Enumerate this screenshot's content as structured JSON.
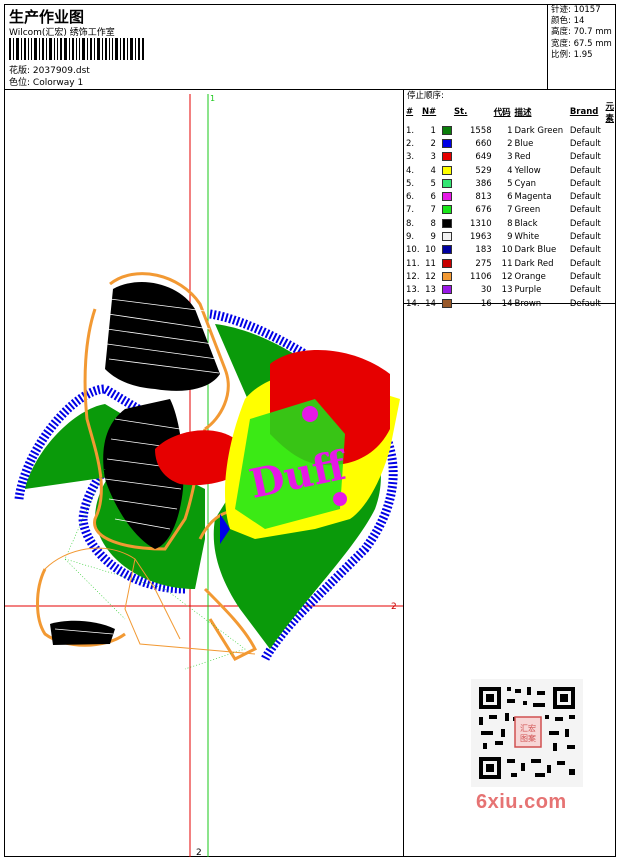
{
  "header": {
    "title": "生产作业图",
    "subtitle": "Wilcom(汇宏) 绣饰工作室",
    "design_file_label": "花版:",
    "design_file": "2037909.dst",
    "colorway_label": "色位:",
    "colorway": "Colorway 1"
  },
  "stats": {
    "stitches_label": "针迹:",
    "stitches": "10157",
    "colors_label": "颜色:",
    "colors": "14",
    "height_label": "高度:",
    "height": "70.7 mm",
    "width_label": "宽度:",
    "width": "67.5 mm",
    "scale_label": "比例:",
    "scale": "1.95"
  },
  "stop_sequence": {
    "title": "停止顺序:",
    "headers": {
      "idx": "#",
      "n": "N#",
      "st": "St.",
      "code": "代码",
      "desc": "描述",
      "brand": "Brand",
      "elem": "元素"
    },
    "rows": [
      {
        "idx": "1.",
        "n": "1",
        "st": "1558",
        "code": "1",
        "desc": "Dark Green",
        "brand": "Default",
        "color": "#0a7d0a"
      },
      {
        "idx": "2.",
        "n": "2",
        "st": "660",
        "code": "2",
        "desc": "Blue",
        "brand": "Default",
        "color": "#0000e6"
      },
      {
        "idx": "3.",
        "n": "3",
        "st": "649",
        "code": "3",
        "desc": "Red",
        "brand": "Default",
        "color": "#e60000"
      },
      {
        "idx": "4.",
        "n": "4",
        "st": "529",
        "code": "4",
        "desc": "Yellow",
        "brand": "Default",
        "color": "#ffff00"
      },
      {
        "idx": "5.",
        "n": "5",
        "st": "386",
        "code": "5",
        "desc": "Cyan",
        "brand": "Default",
        "color": "#33e673"
      },
      {
        "idx": "6.",
        "n": "6",
        "st": "813",
        "code": "6",
        "desc": "Magenta",
        "brand": "Default",
        "color": "#e619e6"
      },
      {
        "idx": "7.",
        "n": "7",
        "st": "676",
        "code": "7",
        "desc": "Green",
        "brand": "Default",
        "color": "#19e619"
      },
      {
        "idx": "8.",
        "n": "8",
        "st": "1310",
        "code": "8",
        "desc": "Black",
        "brand": "Default",
        "color": "#000000"
      },
      {
        "idx": "9.",
        "n": "9",
        "st": "1963",
        "code": "9",
        "desc": "White",
        "brand": "Default",
        "color": "#f2f2f2"
      },
      {
        "idx": "10.",
        "n": "10",
        "st": "183",
        "code": "10",
        "desc": "Dark Blue",
        "brand": "Default",
        "color": "#0000a0"
      },
      {
        "idx": "11.",
        "n": "11",
        "st": "275",
        "code": "11",
        "desc": "Dark Red",
        "brand": "Default",
        "color": "#c80000"
      },
      {
        "idx": "12.",
        "n": "12",
        "st": "1106",
        "code": "12",
        "desc": "Orange",
        "brand": "Default",
        "color": "#f29933"
      },
      {
        "idx": "13.",
        "n": "13",
        "st": "30",
        "code": "13",
        "desc": "Purple",
        "brand": "Default",
        "color": "#9919e6"
      },
      {
        "idx": "14.",
        "n": "14",
        "st": "16",
        "code": "14",
        "desc": "Brown",
        "brand": "Default",
        "color": "#99592a"
      }
    ]
  },
  "design": {
    "guide_label_top": "1",
    "guide_label_right": "2",
    "guide_label_bottom": "2",
    "artwork_text": "Duff"
  },
  "watermark": "6xiu.com",
  "seal_text": "汇宏图案"
}
